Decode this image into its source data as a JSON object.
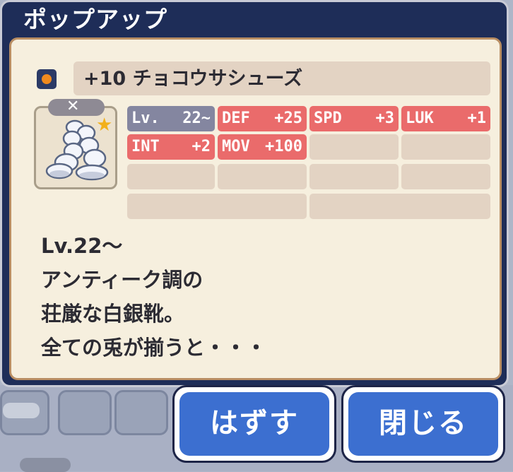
{
  "popup": {
    "title": "ポップアップ"
  },
  "item": {
    "name": "+10 チョコウサシューズ",
    "rarity_color": "#f08a1e",
    "lock_label": "✕",
    "icon": "boot-icon"
  },
  "stats": {
    "level": {
      "label": "Lv.",
      "value": "22~"
    },
    "def": {
      "label": "DEF",
      "value": "+25"
    },
    "spd": {
      "label": "SPD",
      "value": "+3"
    },
    "luk": {
      "label": "LUK",
      "value": "+1"
    },
    "int": {
      "label": "INT",
      "value": "+2"
    },
    "mov": {
      "label": "MOV",
      "value": "+100"
    }
  },
  "description": {
    "lines": [
      "Lv.22～",
      "アンティーク調の",
      "荘厳な白銀靴。",
      "全ての兎が揃うと・・・"
    ]
  },
  "buttons": {
    "unequip": "はずす",
    "close": "閉じる"
  },
  "colors": {
    "header": "#1e2d58",
    "panel": "#f6efde",
    "stat_highlight": "#ea6b6b",
    "button": "#3c6fd0"
  }
}
